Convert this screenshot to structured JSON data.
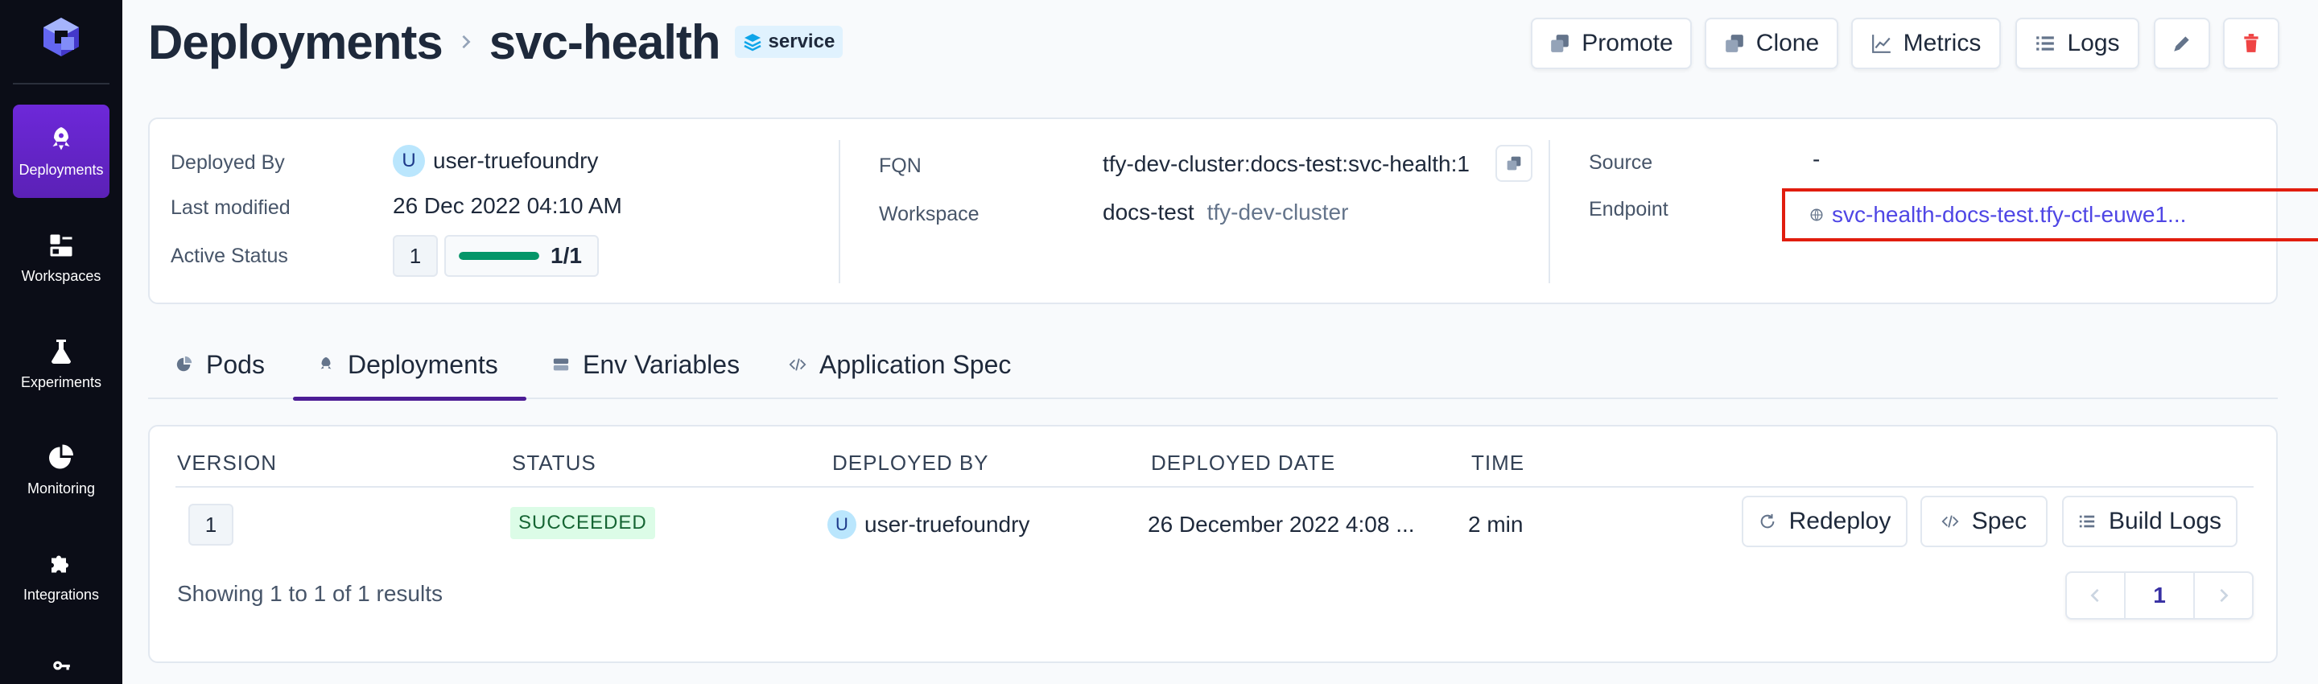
{
  "sidebar": {
    "items": [
      {
        "label": "Deployments",
        "icon": "rocket-icon",
        "active": true
      },
      {
        "label": "Workspaces",
        "icon": "workspaces-icon",
        "active": false
      },
      {
        "label": "Experiments",
        "icon": "flask-icon",
        "active": false
      },
      {
        "label": "Monitoring",
        "icon": "pie-chart-icon",
        "active": false
      },
      {
        "label": "Integrations",
        "icon": "puzzle-icon",
        "active": false
      },
      {
        "label": "",
        "icon": "key-icon",
        "active": false
      }
    ]
  },
  "header": {
    "title": "Deployments",
    "service_name": "svc-health",
    "badge": "service",
    "buttons": {
      "promote": "Promote",
      "clone": "Clone",
      "metrics": "Metrics",
      "logs": "Logs"
    }
  },
  "info": {
    "deployed_by_label": "Deployed By",
    "deployed_by_initial": "U",
    "deployed_by": "user-truefoundry",
    "last_modified_label": "Last modified",
    "last_modified": "26 Dec 2022 04:10 AM",
    "active_status_label": "Active Status",
    "active_count": "1",
    "active_ratio": "1/1",
    "active_fraction": 1.0,
    "fqn_label": "FQN",
    "fqn": "tfy-dev-cluster:docs-test:svc-health:1",
    "workspace_label": "Workspace",
    "workspace": "docs-test",
    "cluster": "tfy-dev-cluster",
    "source_label": "Source",
    "source": "-",
    "endpoint_label": "Endpoint",
    "endpoint": "svc-health-docs-test.tfy-ctl-euwe1..."
  },
  "tabs": [
    {
      "label": "Pods",
      "icon": "pie-chart-icon"
    },
    {
      "label": "Deployments",
      "icon": "rocket-icon",
      "active": true
    },
    {
      "label": "Env Variables",
      "icon": "server-icon"
    },
    {
      "label": "Application Spec",
      "icon": "code-icon"
    }
  ],
  "table": {
    "columns": [
      "VERSION",
      "STATUS",
      "DEPLOYED BY",
      "DEPLOYED DATE",
      "TIME"
    ],
    "rows": [
      {
        "version": "1",
        "status": "SUCCEEDED",
        "deployed_by_initial": "U",
        "deployed_by": "user-truefoundry",
        "deployed_date": "26 December 2022 4:08 ...",
        "time": "2 min",
        "actions": {
          "redeploy": "Redeploy",
          "spec": "Spec",
          "build_logs": "Build Logs"
        }
      }
    ],
    "results_text": "Showing 1 to 1 of 1 results",
    "current_page": "1"
  },
  "colors": {
    "accent": "#5b21b6",
    "link": "#4f46e5",
    "success_fill": "#059669",
    "highlight": "#e11d0e"
  }
}
